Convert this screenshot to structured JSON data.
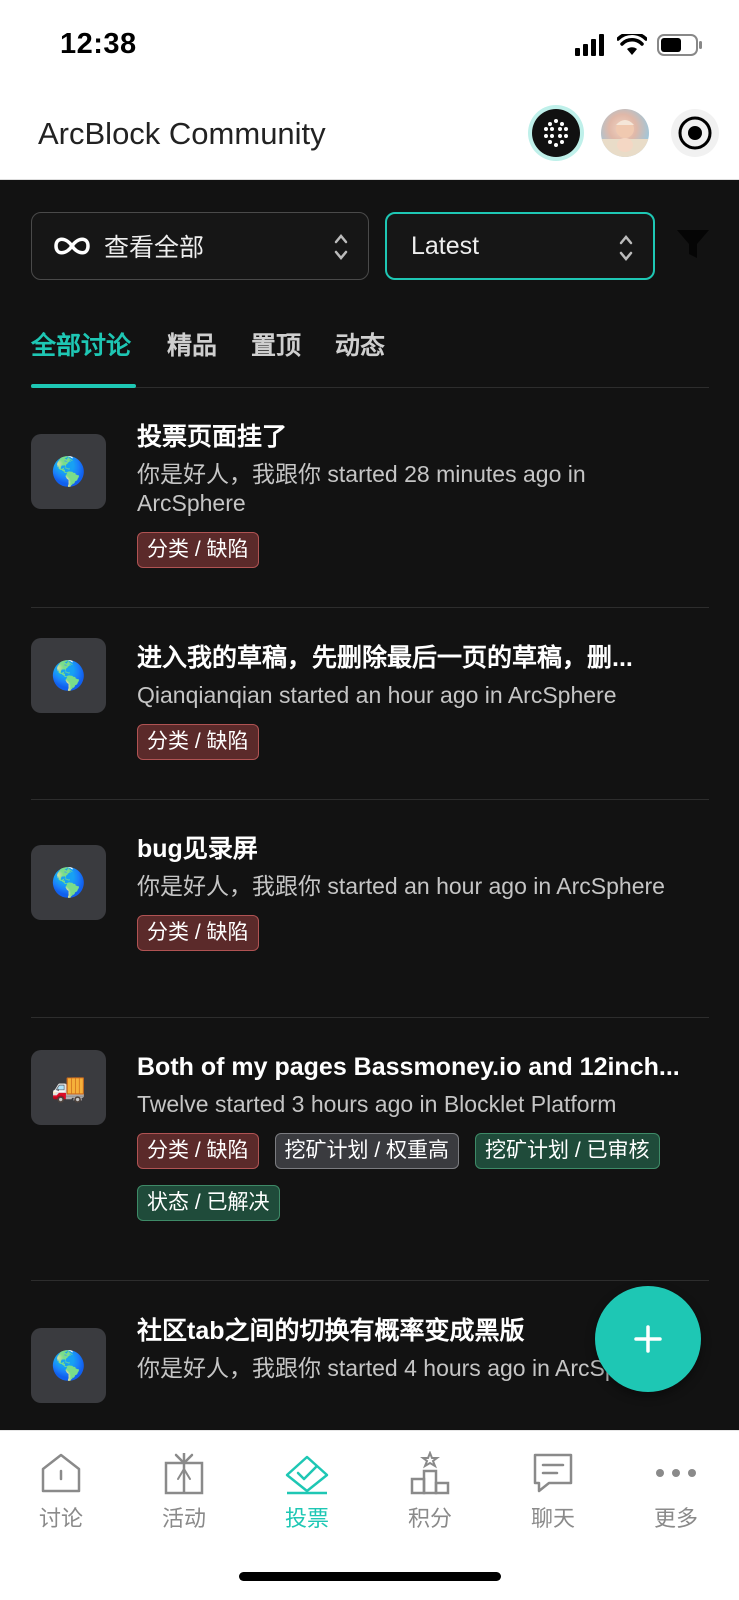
{
  "status_bar": {
    "time": "12:38"
  },
  "header": {
    "title": "ArcBlock Community"
  },
  "filters": {
    "scope_label": "查看全部",
    "sort_label": "Latest"
  },
  "tabs": [
    {
      "label": "全部讨论",
      "active": true
    },
    {
      "label": "精品",
      "active": false
    },
    {
      "label": "置顶",
      "active": false
    },
    {
      "label": "动态",
      "active": false
    }
  ],
  "posts": [
    {
      "icon": "🌎",
      "title": "投票页面挂了",
      "meta": "你是好人，我跟你 started 28 minutes ago in ArcSphere",
      "tags": [
        {
          "label": "分类 / 缺陷",
          "color": "red"
        }
      ]
    },
    {
      "icon": "🌎",
      "title": "进入我的草稿，先删除最后一页的草稿，删...",
      "meta": "Qianqianqian started an hour ago in ArcSphere",
      "tags": [
        {
          "label": "分类 / 缺陷",
          "color": "red"
        }
      ]
    },
    {
      "icon": "🌎",
      "title": "bug见录屏",
      "meta": "你是好人，我跟你 started an hour ago in ArcSphere",
      "tags": [
        {
          "label": "分类 / 缺陷",
          "color": "red"
        }
      ]
    },
    {
      "icon": "🚚",
      "title": "Both of my pages Bassmoney.io and 12inch...",
      "meta": "Twelve started 3 hours ago in Blocklet Platform",
      "tags": [
        {
          "label": "分类 / 缺陷",
          "color": "red"
        },
        {
          "label": "挖矿计划 / 权重高",
          "color": "gray"
        },
        {
          "label": "挖矿计划 / 已审核",
          "color": "green"
        },
        {
          "label": "状态 / 已解决",
          "color": "green"
        }
      ]
    },
    {
      "icon": "🌎",
      "title": "社区tab之间的切换有概率变成黑版",
      "meta": "你是好人，我跟你 started 4 hours ago in ArcSphere",
      "tags": []
    }
  ],
  "bottom_nav": [
    {
      "label": "讨论",
      "icon": "home-icon",
      "active": false
    },
    {
      "label": "活动",
      "icon": "gift-icon",
      "active": false
    },
    {
      "label": "投票",
      "icon": "vote-icon",
      "active": true
    },
    {
      "label": "积分",
      "icon": "podium-icon",
      "active": false
    },
    {
      "label": "聊天",
      "icon": "chat-icon",
      "active": false
    },
    {
      "label": "更多",
      "icon": "more-icon",
      "active": false
    }
  ],
  "colors": {
    "accent": "#1ec7b4",
    "background": "#121212"
  }
}
